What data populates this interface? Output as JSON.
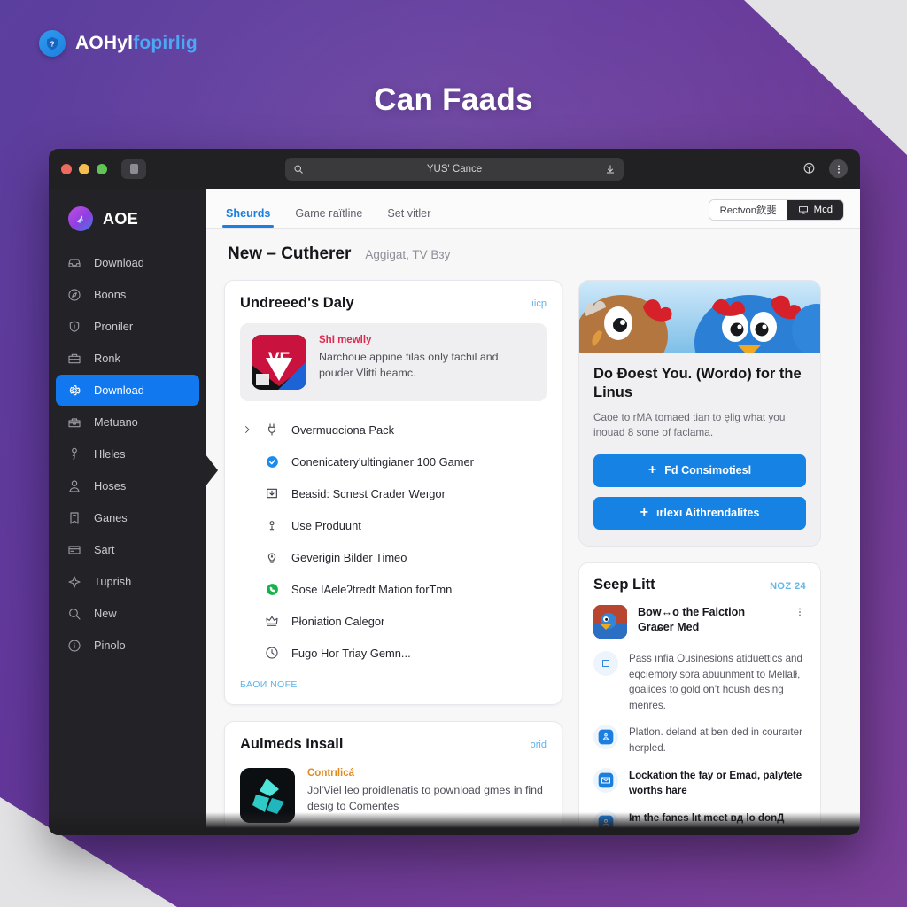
{
  "brand": {
    "name_primary": "AOHyl",
    "name_secondary": "fopirlig",
    "icon": "question-mark-badge-icon"
  },
  "headline": "Can Faads",
  "browser": {
    "traffic_lights": [
      "close",
      "minimize",
      "zoom"
    ],
    "tab_chip_icon": "tab-thumbnail-icon",
    "omnibox": {
      "search_icon": "search-icon",
      "url": "YUS' Cance",
      "download_icon": "download-arrow-icon"
    },
    "toolbar_right": {
      "extension_icon": "extension-icon",
      "menu_icon": "overflow-menu-icon"
    }
  },
  "sidebar": {
    "logo_icon": "app-logo-icon",
    "title": "AOE",
    "items": [
      {
        "label": "Download",
        "icon": "inbox-icon",
        "active": false
      },
      {
        "label": "Boons",
        "icon": "compass-icon",
        "active": false
      },
      {
        "label": "Proniler",
        "icon": "shield-icon",
        "active": false
      },
      {
        "label": "Ronk",
        "icon": "briefcase-icon",
        "active": false
      },
      {
        "label": "Download",
        "icon": "gear-icon",
        "active": true
      },
      {
        "label": "Metuano",
        "icon": "toolbox-icon",
        "active": false
      },
      {
        "label": "Hleles",
        "icon": "key-person-icon",
        "active": false
      },
      {
        "label": "Hoses",
        "icon": "user-icon",
        "active": false
      },
      {
        "label": "Ganes",
        "icon": "bookmark-icon",
        "active": false
      },
      {
        "label": "Sart",
        "icon": "card-icon",
        "active": false
      },
      {
        "label": "Tuprish",
        "icon": "sparkle-icon",
        "active": false
      },
      {
        "label": "New",
        "icon": "search-icon",
        "active": false
      },
      {
        "label": "Pinolo",
        "icon": "info-icon",
        "active": false
      }
    ]
  },
  "content": {
    "tabs": [
      {
        "label": "Sheurds",
        "selected": true
      },
      {
        "label": "Game гaïtline",
        "selected": false
      },
      {
        "label": "Set vitler",
        "selected": false
      }
    ],
    "segmented": [
      {
        "label": "Rectvon欽斐",
        "icon": "",
        "on": false
      },
      {
        "label": "Mcd",
        "icon": "monitor-icon",
        "on": true
      }
    ],
    "page_title": "New – Cutherer",
    "page_subtitle": "Aggigat, TV Bзy"
  },
  "main_card": {
    "title": "Undreeed's Daly",
    "link": "ıicp",
    "promo": {
      "art_icon": "vf-logo-icon",
      "art_label": "VF",
      "kicker": "SһI mewlly",
      "description": "Narchoue appine filaѕ only tachil and pouder Vlitti heamc."
    },
    "rows": [
      {
        "icon": "plug-icon",
        "label": "Overmuɑciona Pack",
        "chevron": true,
        "icon_color": "#4a4a54"
      },
      {
        "icon": "check-circle-icon",
        "label": "Conenicatery'ultingianer 100 Gamer",
        "chevron": false,
        "icon_color": "#1a8cf0"
      },
      {
        "icon": "download-box-icon",
        "label": "Beasid: Scnest Crader Weıgor",
        "chevron": false,
        "icon_color": "#3b3b44"
      },
      {
        "icon": "location-pin-icon",
        "label": "Use Produunt",
        "chevron": false,
        "icon_color": "#4a4a54"
      },
      {
        "icon": "lightbulb-icon",
        "label": "Geverigin Bilder Timeo",
        "chevron": false,
        "icon_color": "#4a4a54"
      },
      {
        "icon": "phone-circle-icon",
        "label": "Sose IАeleʔtredt Mation forTmn",
        "chevron": false,
        "icon_color": "#14b34a"
      },
      {
        "icon": "crown-icon",
        "label": "Płoniation Calegor",
        "chevron": false,
        "icon_color": "#4a4a54"
      },
      {
        "icon": "clock-icon",
        "label": "Fugo Hor Triay Gemn...",
        "chevron": false,
        "icon_color": "#4a4a54"
      }
    ],
    "more_link": "БАОИ NOFE"
  },
  "bottom_card": {
    "title": "Aulmeds Insall",
    "link": "orid",
    "promo": {
      "art_icon": "crystal-shards-icon",
      "kicker": "Contrılicá",
      "description": "Jol'Viel leo proidlenatis to pownload gmes in find desiɡ to Comentes"
    }
  },
  "hero": {
    "image_alt": "two cartoon chicken characters",
    "title": "Do Đoest You. (Wordo) for the Linus",
    "description": "Caoe to rMА tomaed tian to ęlig what you inouad 8 sone of faclama.",
    "buttons": [
      {
        "label": "Fd Consimotiesl",
        "icon": "plus-icon"
      },
      {
        "label": "ırlexı Aithrendalites",
        "icon": "plus-icon"
      }
    ]
  },
  "side_list": {
    "title": "Seep Litt",
    "badge": "NOZ 24",
    "feature": {
      "thumb_icon": "game-thumbnail-icon",
      "title": "Bow↔o the Faiction Graɕer Med",
      "menu_icon": "kebab-menu-icon"
    },
    "items": [
      {
        "icon": "square-outline-icon",
        "text": "Pass ınfia Ousinesions atiduettics and eqcıemory ѕora abuunment to Mellalł, goaiices to gold on’t housh desing menres.",
        "bold": false
      },
      {
        "icon": "person-badge-icon",
        "text": "Platlon. deland at ben ded in couraıter herpled.",
        "bold": false
      },
      {
        "icon": "mail-icon",
        "text": "Lockation the fay or Emad, palytete worths hare",
        "bold": true
      },
      {
        "icon": "user-circle-icon",
        "text": "I̵̵m the fanes lıt meet вд lo donД",
        "bold": true
      }
    ]
  },
  "colors": {
    "accent_blue": "#1278f0",
    "link_blue": "#5fb4ea",
    "backdrop_purple": "#63379b",
    "window_dark": "#1e1e20",
    "sidebar_dark": "#232327"
  }
}
